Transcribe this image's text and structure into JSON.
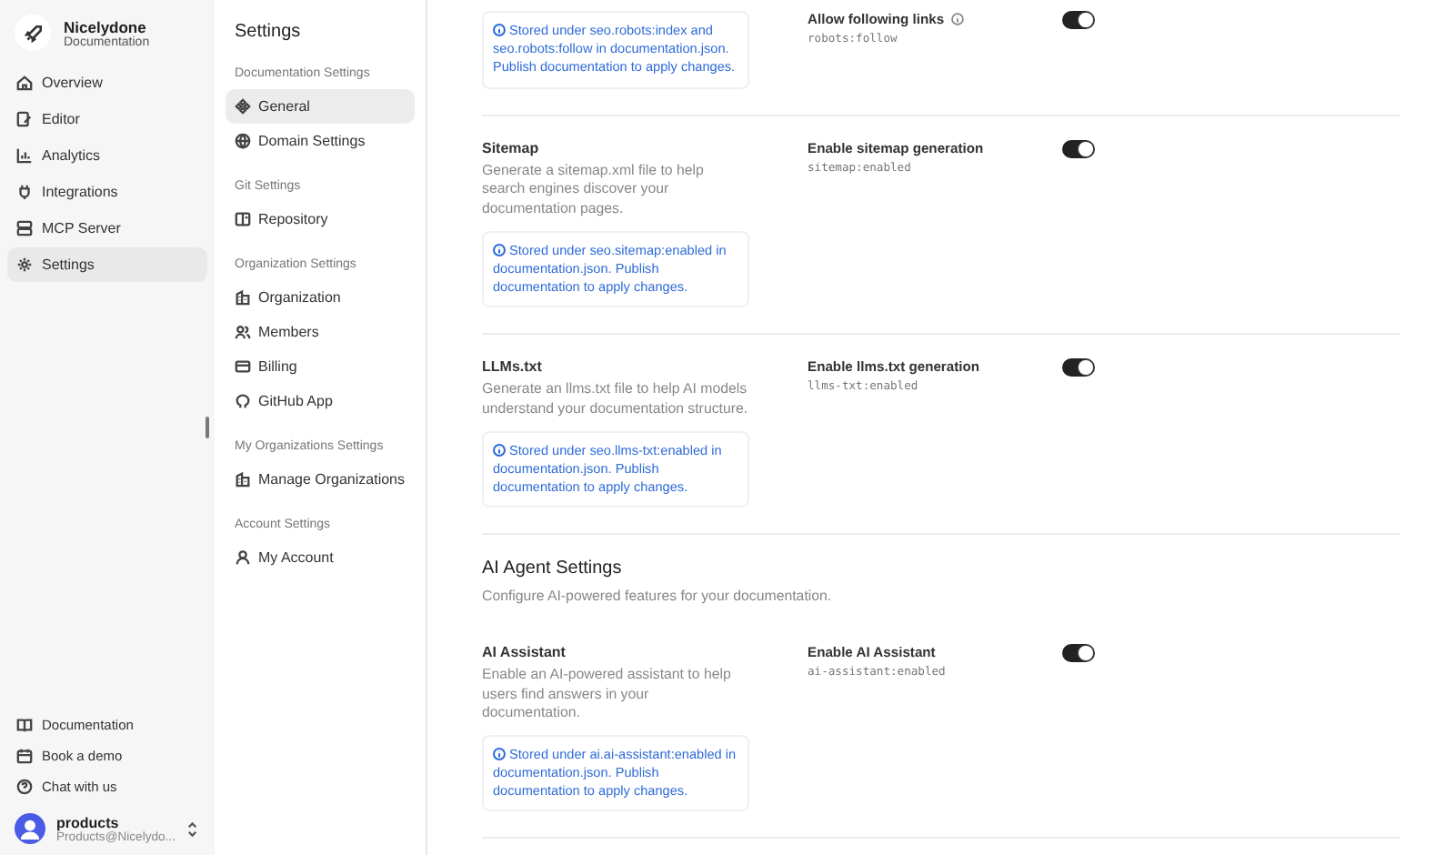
{
  "sidebar": {
    "brand": {
      "name": "Nicelydone",
      "subtitle": "Documentation"
    },
    "items": [
      {
        "label": "Overview",
        "selected": false
      },
      {
        "label": "Editor",
        "selected": false
      },
      {
        "label": "Analytics",
        "selected": false
      },
      {
        "label": "Integrations",
        "selected": false
      },
      {
        "label": "MCP Server",
        "selected": false
      },
      {
        "label": "Settings",
        "selected": true
      }
    ],
    "footer_links": [
      {
        "label": "Documentation"
      },
      {
        "label": "Book a demo"
      },
      {
        "label": "Chat with us"
      }
    ],
    "user": {
      "name": "products",
      "email": "Products@Nicelydo..."
    }
  },
  "settings_nav": {
    "title": "Settings",
    "groups": [
      {
        "heading": "Documentation Settings",
        "items": [
          {
            "label": "General",
            "selected": true
          },
          {
            "label": "Domain Settings",
            "selected": false
          }
        ]
      },
      {
        "heading": "Git Settings",
        "items": [
          {
            "label": "Repository",
            "selected": false
          }
        ]
      },
      {
        "heading": "Organization Settings",
        "items": [
          {
            "label": "Organization",
            "selected": false
          },
          {
            "label": "Members",
            "selected": false
          },
          {
            "label": "Billing",
            "selected": false
          },
          {
            "label": "GitHub App",
            "selected": false
          }
        ]
      },
      {
        "heading": "My Organizations Settings",
        "items": [
          {
            "label": "Manage Organizations",
            "selected": false
          }
        ]
      },
      {
        "heading": "Account Settings",
        "items": [
          {
            "label": "My Account",
            "selected": false
          }
        ]
      }
    ]
  },
  "main": {
    "sections": [
      {
        "kind": "setting",
        "note": "Stored under seo.robots:index and seo.robots:follow in documentation.json. Publish documentation to apply changes.",
        "option": {
          "label": "Allow following links",
          "key": "robots:follow",
          "has_info": true,
          "on": true
        }
      },
      {
        "kind": "setting",
        "title": "Sitemap",
        "description": "Generate a sitemap.xml file to help search engines discover your documentation pages.",
        "note": "Stored under seo.sitemap:enabled in documentation.json. Publish documentation to apply changes.",
        "option": {
          "label": "Enable sitemap generation",
          "key": "sitemap:enabled",
          "has_info": false,
          "on": true
        }
      },
      {
        "kind": "setting",
        "title": "LLMs.txt",
        "description": "Generate an llms.txt file to help AI models understand your documentation structure.",
        "note": "Stored under seo.llms-txt:enabled in documentation.json. Publish documentation to apply changes.",
        "option": {
          "label": "Enable llms.txt generation",
          "key": "llms-txt:enabled",
          "has_info": false,
          "on": true
        }
      },
      {
        "kind": "heading",
        "title": "AI Agent Settings",
        "description": "Configure AI-powered features for your documentation."
      },
      {
        "kind": "setting",
        "title": "AI Assistant",
        "description": "Enable an AI-powered assistant to help users find answers in your documentation.",
        "note": "Stored under ai.ai-assistant:enabled in documentation.json. Publish documentation to apply changes.",
        "option": {
          "label": "Enable AI Assistant",
          "key": "ai-assistant:enabled",
          "has_info": false,
          "on": true
        }
      }
    ]
  }
}
